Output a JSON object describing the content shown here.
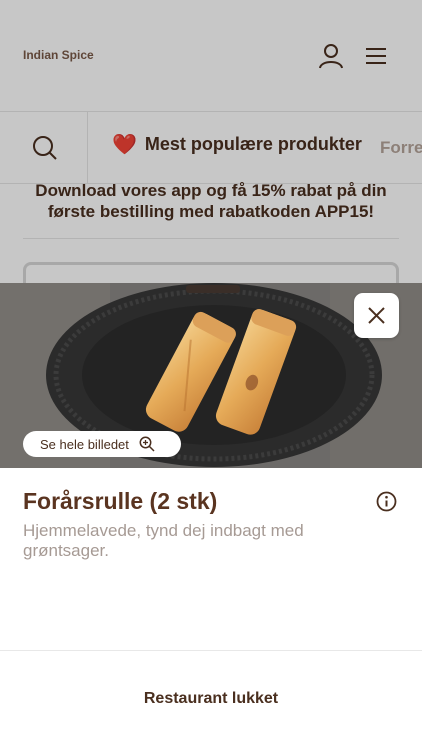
{
  "header": {
    "brand": "Indian Spice",
    "icons": [
      "user-icon",
      "menu-icon"
    ]
  },
  "categories": {
    "search_icon": "search-icon",
    "popular_emoji": "❤️",
    "popular_label": "Mest populære produkter",
    "next_label": "Forretter"
  },
  "promo": {
    "text": "Download vores app og få 15% rabat på din første bestilling med rabatkoden APP15!"
  },
  "modal": {
    "see_image_label": "Se hele billedet",
    "title": "Forårsrulle (2 stk)",
    "description": "Hjemmelavede, tynd dej indbagt med grøntsager.",
    "status": "Restaurant lukket"
  },
  "colors": {
    "primary_text": "#4a2f1f",
    "muted_text": "#a69a94",
    "overlay": "rgba(0,0,0,0.22)"
  }
}
